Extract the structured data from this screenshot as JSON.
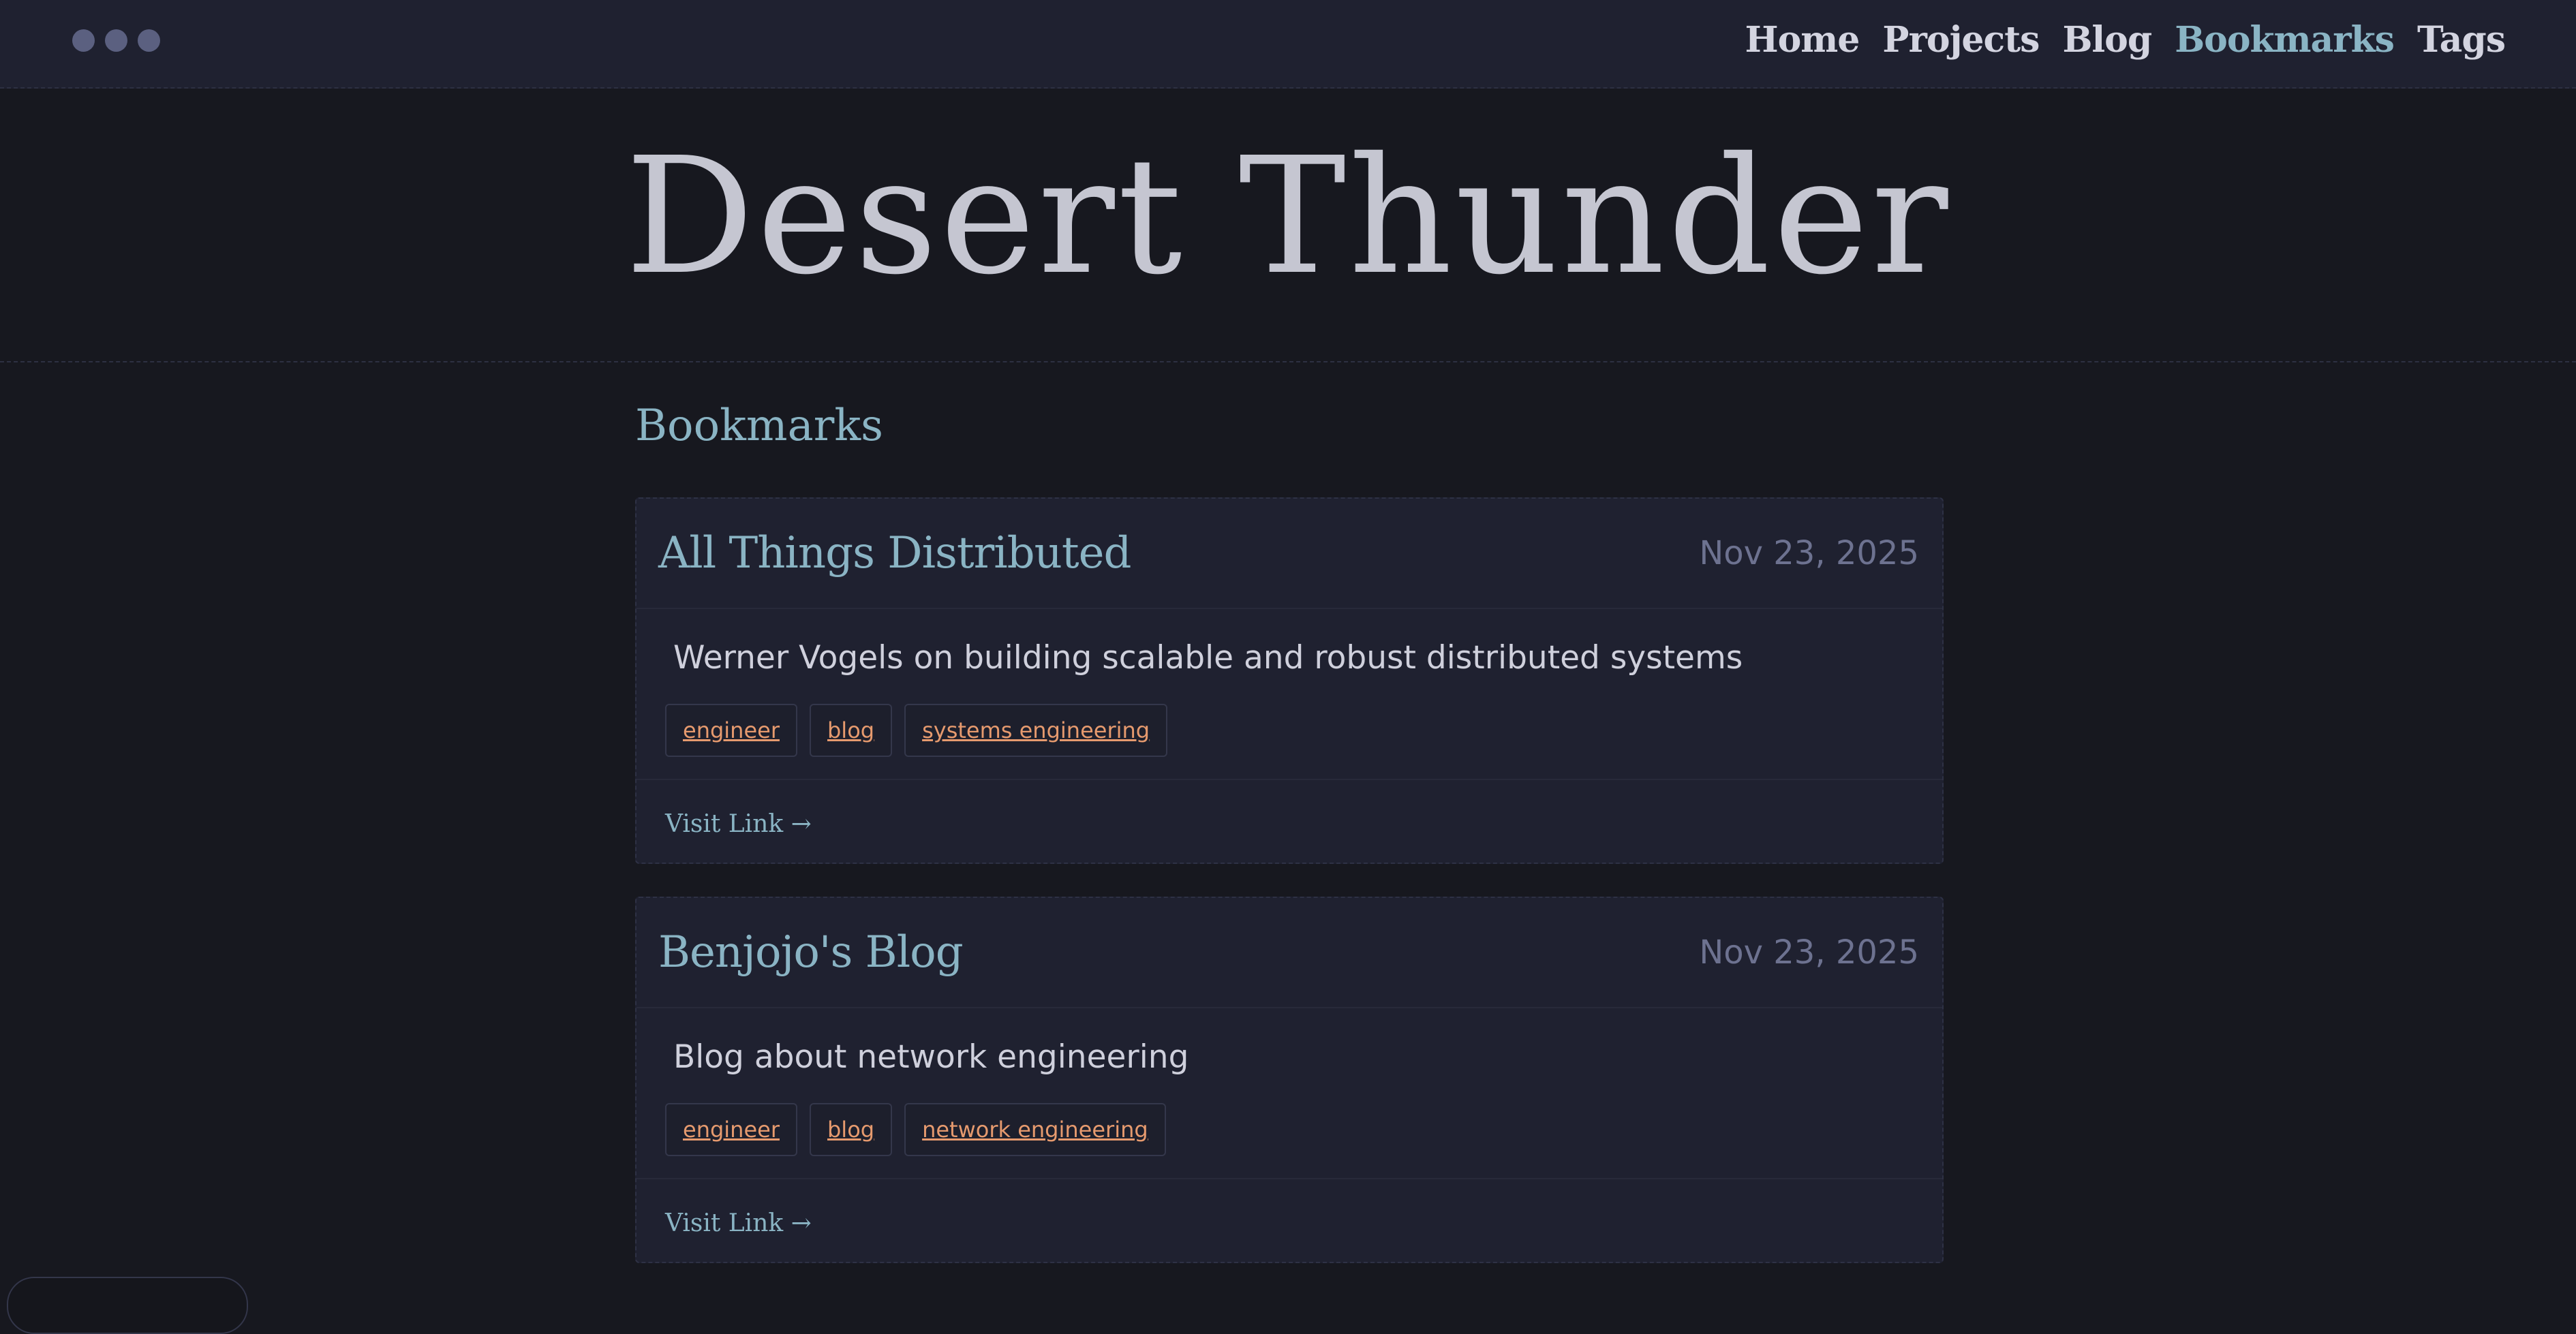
{
  "nav": {
    "items": [
      {
        "label": "Home",
        "active": false
      },
      {
        "label": "Projects",
        "active": false
      },
      {
        "label": "Blog",
        "active": false
      },
      {
        "label": "Bookmarks",
        "active": true
      },
      {
        "label": "Tags",
        "active": false
      }
    ]
  },
  "hero": {
    "title": "Desert Thunder"
  },
  "main": {
    "section_title": "Bookmarks",
    "bookmarks": [
      {
        "title": "All Things Distributed",
        "date": "Nov 23, 2025",
        "description": "Werner Vogels on building scalable and robust distributed systems",
        "tags": [
          "engineer",
          "blog",
          "systems engineering"
        ],
        "link_label": "Visit Link →"
      },
      {
        "title": "Benjojo's Blog",
        "date": "Nov 23, 2025",
        "description": "Blog about network engineering",
        "tags": [
          "engineer",
          "blog",
          "network engineering"
        ],
        "link_label": "Visit Link →"
      }
    ]
  },
  "colors": {
    "background": "#17181f",
    "topbar": "#1f2130",
    "accent": "#8ab4c4",
    "tag_text": "#e69a6e",
    "muted": "#6d7290"
  }
}
